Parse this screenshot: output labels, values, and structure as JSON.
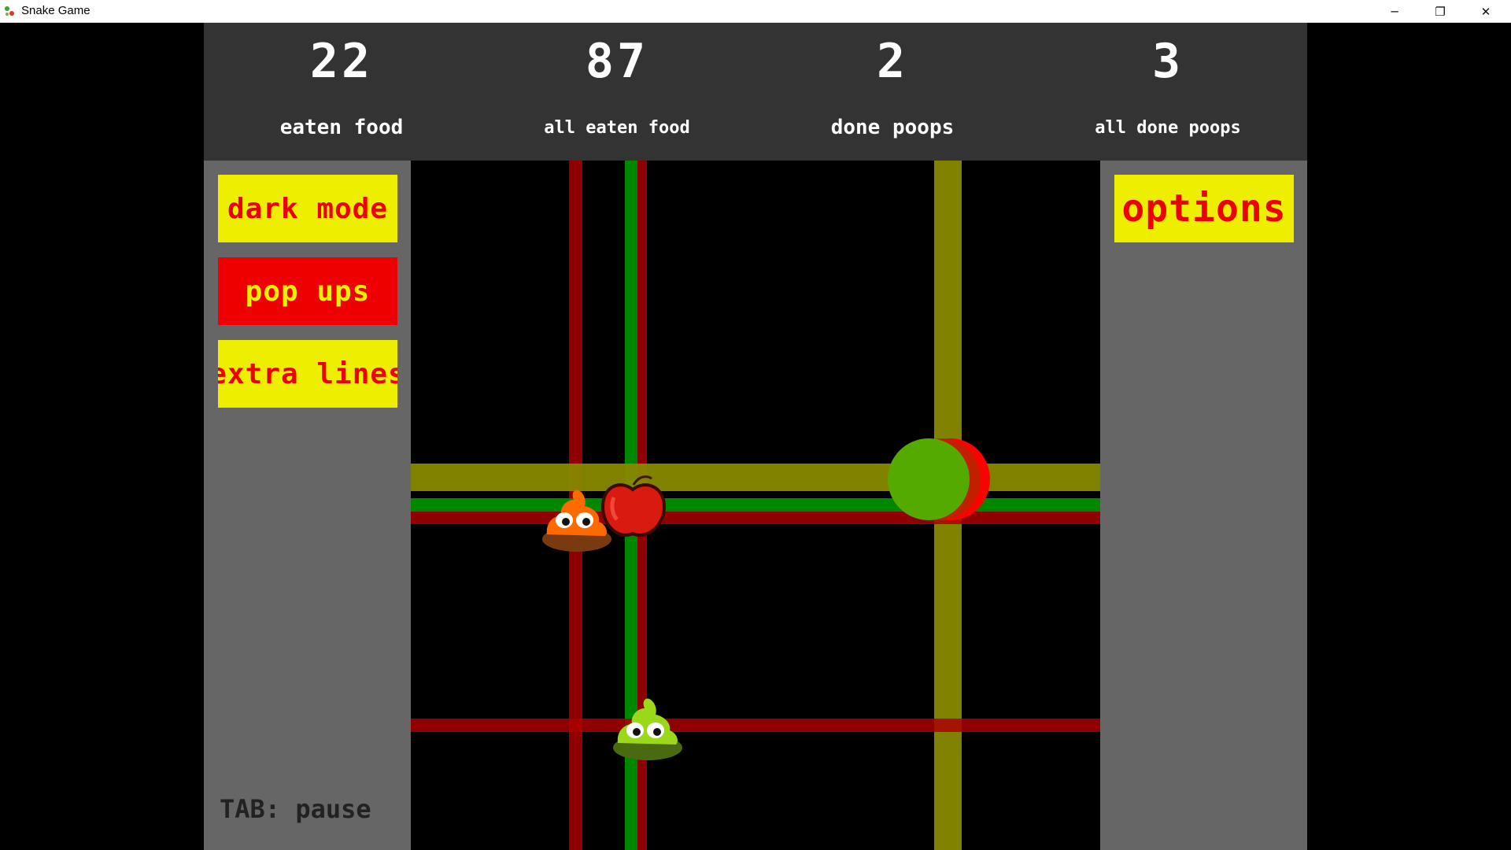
{
  "window": {
    "title": "Snake Game",
    "controls": {
      "minimize": "─",
      "maximize": "❐",
      "close": "✕"
    }
  },
  "stats": [
    {
      "value": "22",
      "label": "eaten food"
    },
    {
      "value": "87",
      "label": "all eaten food"
    },
    {
      "value": "2",
      "label": "done poops"
    },
    {
      "value": "3",
      "label": "all done poops"
    }
  ],
  "left_panel": {
    "buttons": [
      {
        "label": "dark mode",
        "state": "off"
      },
      {
        "label": "pop ups",
        "state": "on"
      },
      {
        "label": "extra lines",
        "state": "off"
      }
    ],
    "hint": "TAB: pause"
  },
  "right_panel": {
    "options_label": "options"
  },
  "colors": {
    "header_bg": "#333333",
    "panel_bg": "#666666",
    "button_yellow": "#eeee00",
    "button_red": "#ee0000",
    "line_red": "#aa0000",
    "line_green": "#009600",
    "line_olive": "#888800",
    "snake_green": "#55aa00"
  },
  "icons": {
    "app": "snake-game-app-icon",
    "snake": "snake-head",
    "food": "apple",
    "poop_orange": "orange-poop",
    "poop_green": "green-poop"
  }
}
